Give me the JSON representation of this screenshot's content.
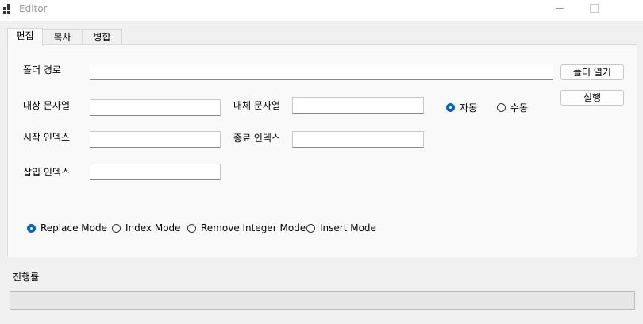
{
  "window": {
    "title": "Editor",
    "icon": "app-window-icon"
  },
  "tabs": [
    {
      "label": "편집",
      "selected": true
    },
    {
      "label": "복사",
      "selected": false
    },
    {
      "label": "병합",
      "selected": false
    }
  ],
  "edit": {
    "folder_path_label": "폴더 경로",
    "folder_path_value": "",
    "open_folder_button": "폴더 열기",
    "run_button": "실행",
    "target_string_label": "대상 문자열",
    "target_string_value": "",
    "replace_string_label": "대체 문자열",
    "replace_string_value": "",
    "start_index_label": "시작 인덱스",
    "start_index_value": "",
    "end_index_label": "종료 인덱스",
    "end_index_value": "",
    "insert_index_label": "삽입 인덱스",
    "insert_index_value": "",
    "run_mode": [
      {
        "label": "자동",
        "checked": true
      },
      {
        "label": "수동",
        "checked": false
      }
    ],
    "modes": [
      {
        "label": "Replace Mode",
        "checked": true
      },
      {
        "label": "Index Mode",
        "checked": false
      },
      {
        "label": "Remove Integer Mode",
        "checked": false
      },
      {
        "label": "Insert Mode",
        "checked": false
      }
    ]
  },
  "progress": {
    "label": "진행률",
    "value": 0
  },
  "colors": {
    "accent": "#0a60c9",
    "progress_fill": "#06b025"
  }
}
